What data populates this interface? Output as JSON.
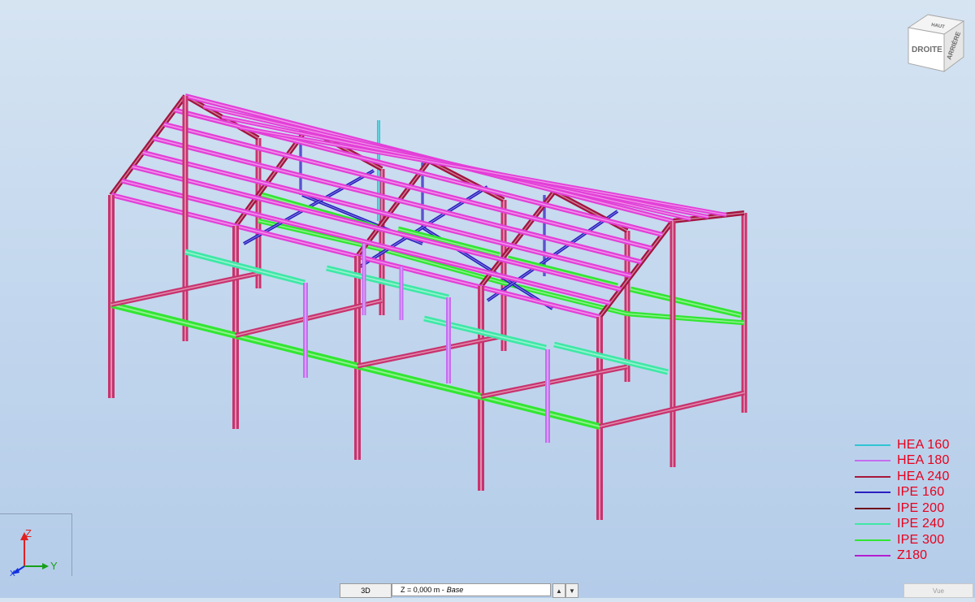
{
  "view_cube": {
    "face_front": "DROITE",
    "face_side": "ARRIÈRE",
    "face_top": "HAUT"
  },
  "legend": {
    "items": [
      {
        "label": "HEA 160",
        "color": "#2fc4d2"
      },
      {
        "label": "HEA 180",
        "color": "#c56df0"
      },
      {
        "label": "HEA 240",
        "color": "#a8183c"
      },
      {
        "label": "IPE 160",
        "color": "#2a1fc0"
      },
      {
        "label": "IPE 200",
        "color": "#6e0b1a"
      },
      {
        "label": "IPE 240",
        "color": "#3ee8a6"
      },
      {
        "label": "IPE 300",
        "color": "#32e632"
      },
      {
        "label": "Z180",
        "color": "#b21fd0"
      }
    ]
  },
  "axes": {
    "z": "Z",
    "y": "Y",
    "x": "X"
  },
  "bottom_bar": {
    "view_mode": "3D",
    "level_prefix": "Z = 0,000 m - ",
    "level_name": "Base",
    "spin_up": "▲",
    "spin_down": "▼",
    "view_label": "Vue"
  },
  "colors": {
    "column": "#c8336e",
    "rafter": "#a3133f",
    "purlin": "#e33fd8",
    "beam_green": "#32e632",
    "beam_aqua": "#3ee8a6",
    "bracing": "#2a1fc0",
    "post": "#c56df0",
    "hea160": "#2fc4d2"
  }
}
